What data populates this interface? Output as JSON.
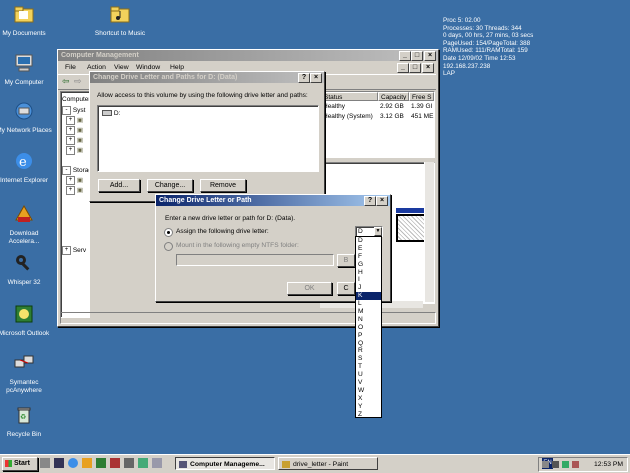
{
  "desktop": {
    "icons": [
      {
        "label": "My Documents",
        "icon": "folder-documents-icon"
      },
      {
        "label": "Shortcut to Music",
        "icon": "folder-music-icon"
      },
      {
        "label": "My Computer",
        "icon": "computer-icon"
      },
      {
        "label": "My Network Places",
        "icon": "network-icon"
      },
      {
        "label": "Internet Explorer",
        "icon": "internet-explorer-icon"
      },
      {
        "label": "Download Accelera...",
        "icon": "download-accelerator-icon"
      },
      {
        "label": "Whisper 32",
        "icon": "whisper-key-icon"
      },
      {
        "label": "Microsoft Outlook",
        "icon": "outlook-icon"
      },
      {
        "label": "Symantec pcAnywhere",
        "icon": "pcanywhere-icon"
      },
      {
        "label": "Recycle Bin",
        "icon": "recycle-bin-icon"
      }
    ],
    "sysinfo": [
      "Proc 5: 02.00",
      "Processes: 30   Threads: 344",
      "0 days, 00 hrs, 27 mins, 03 secs",
      "PageUsed: 154/PageTotal: 388",
      "RAMUsed: 111/RAMTotal: 159",
      "Date 12/09/02 Time 12:53",
      "192.168.237.238",
      "LAP"
    ]
  },
  "computer_management": {
    "title": "Computer Management",
    "menu": [
      "File",
      "Action",
      "View",
      "Window",
      "Help"
    ],
    "tree": [
      "Computer",
      "Syst",
      "Storage",
      "Serv"
    ],
    "columns": [
      "Status",
      "Capacity",
      "Free S"
    ],
    "rows": [
      [
        "Healthy",
        "2.92 GB",
        "1.39 GI"
      ],
      [
        "Healthy (System)",
        "3.12 GB",
        "451 ME"
      ]
    ]
  },
  "paths_dialog": {
    "title": "Change Drive Letter and Paths for D: (Data)",
    "help": "?",
    "close": "×",
    "description": "Allow access to this volume by using the following drive letter and paths:",
    "entry": "D:",
    "add": "Add...",
    "change": "Change...",
    "remove": "Remove"
  },
  "change_dialog": {
    "title": "Change Drive Letter or Path",
    "help": "?",
    "close": "×",
    "prompt": "Enter a new drive letter or path for D: (Data).",
    "assign_label": "Assign the following drive letter:",
    "mount_label": "Mount in the following empty NTFS folder:",
    "browse": "B",
    "ok": "OK",
    "cancel": "C",
    "selected_letter": "D",
    "letters": [
      "D",
      "E",
      "F",
      "G",
      "H",
      "I",
      "J",
      "K",
      "L",
      "M",
      "N",
      "O",
      "P",
      "Q",
      "R",
      "S",
      "T",
      "U",
      "V",
      "W",
      "X",
      "Y",
      "Z"
    ],
    "highlighted": "K"
  },
  "taskbar": {
    "start": "Start",
    "buttons": [
      "Computer Manageme...",
      "drive_letter - Paint"
    ],
    "lang": "EN",
    "time": "12:53 PM"
  }
}
